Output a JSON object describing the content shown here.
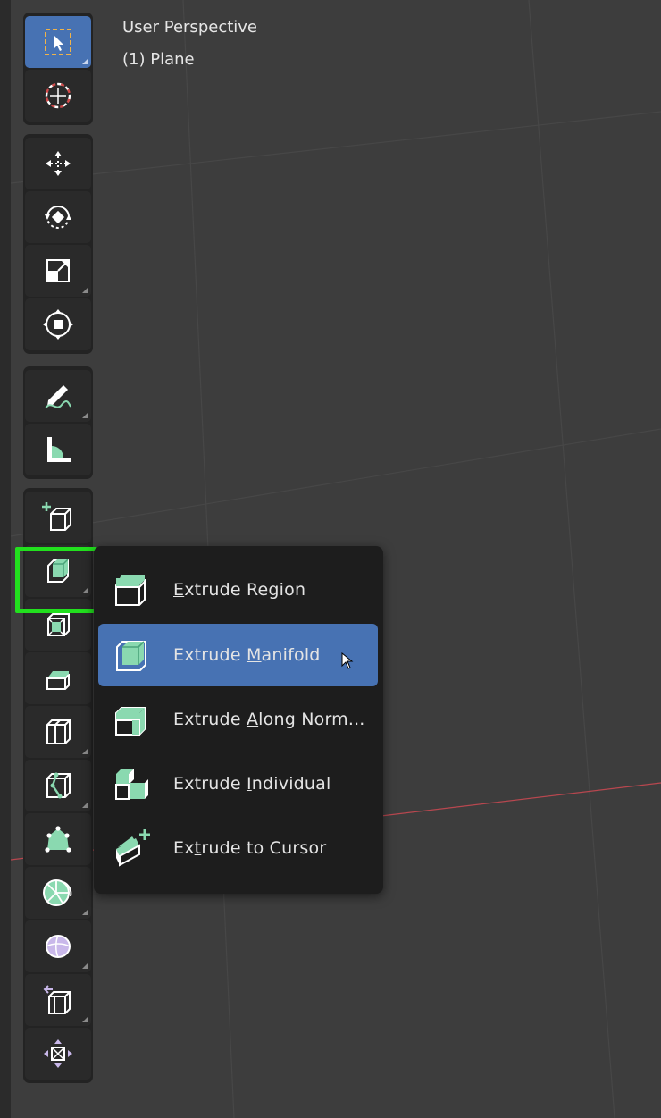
{
  "viewport": {
    "view_name": "User Perspective",
    "object_name": "(1) Plane"
  },
  "toolbar": {
    "groups": [
      [
        "select-box",
        "cursor"
      ],
      [
        "move",
        "rotate",
        "scale",
        "transform"
      ],
      [
        "annotate",
        "measure"
      ],
      [
        "add-cube",
        "extrude",
        "inset",
        "bevel",
        "loop-cut",
        "knife",
        "poly-build",
        "spin",
        "smooth",
        "edge-slide",
        "shrink-fatten"
      ]
    ],
    "highlighted_tool": "extrude"
  },
  "popup": {
    "items": [
      {
        "pre": "",
        "key": "E",
        "post": "xtrude Region",
        "icon": "extrude-region-icon"
      },
      {
        "pre": "Extrude ",
        "key": "M",
        "post": "anifold",
        "icon": "extrude-manifold-icon"
      },
      {
        "pre": "Extrude ",
        "key": "A",
        "post": "long Norm...",
        "icon": "extrude-along-normals-icon"
      },
      {
        "pre": "Extrude ",
        "key": "I",
        "post": "ndividual",
        "icon": "extrude-individual-icon"
      },
      {
        "pre": "Ex",
        "key": "t",
        "post": "rude to Cursor",
        "icon": "extrude-to-cursor-icon"
      }
    ],
    "active_index": 1
  },
  "colors": {
    "viewport_bg": "#3d3d3d",
    "active_blue": "#4772b3",
    "highlight_green": "#22e01e",
    "icon_mint": "#8ad9b0",
    "menu_bg": "#1d1d1d",
    "x_axis_red": "#b8474f"
  }
}
